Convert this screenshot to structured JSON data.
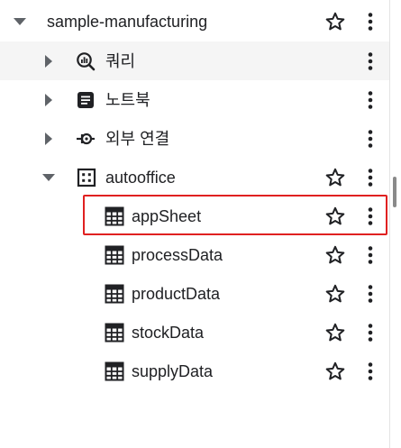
{
  "explorer": {
    "project": {
      "label": "sample-manufacturing"
    },
    "queries": {
      "label": "쿼리"
    },
    "notebooks": {
      "label": "노트북"
    },
    "external": {
      "label": "외부 연결"
    },
    "dataset": {
      "label": "autooffice"
    },
    "tables": [
      {
        "label": "appSheet",
        "selected": true
      },
      {
        "label": "processData"
      },
      {
        "label": "productData"
      },
      {
        "label": "stockData"
      },
      {
        "label": "supplyData"
      }
    ]
  },
  "colors": {
    "selection_outline": "#e02020",
    "hover_row": "#f5f5f5",
    "icon": "#202124"
  }
}
